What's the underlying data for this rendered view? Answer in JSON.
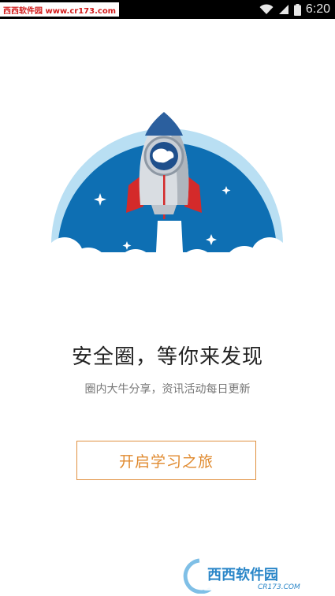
{
  "status_bar": {
    "watermark": "西西软件园 www.cr173.com",
    "time": "6:20"
  },
  "main": {
    "headline": "安全圈，等你来发现",
    "subline": "圈内大牛分享，资讯活动每日更新",
    "start_button": "开启学习之旅"
  },
  "watermark_bottom": {
    "brand": "西西软件园",
    "url": "CR173.COM"
  },
  "colors": {
    "sky": "#0e6fb3",
    "ring": "#b9dff3",
    "accent": "#e08a2f",
    "fin": "#d42a2a"
  }
}
